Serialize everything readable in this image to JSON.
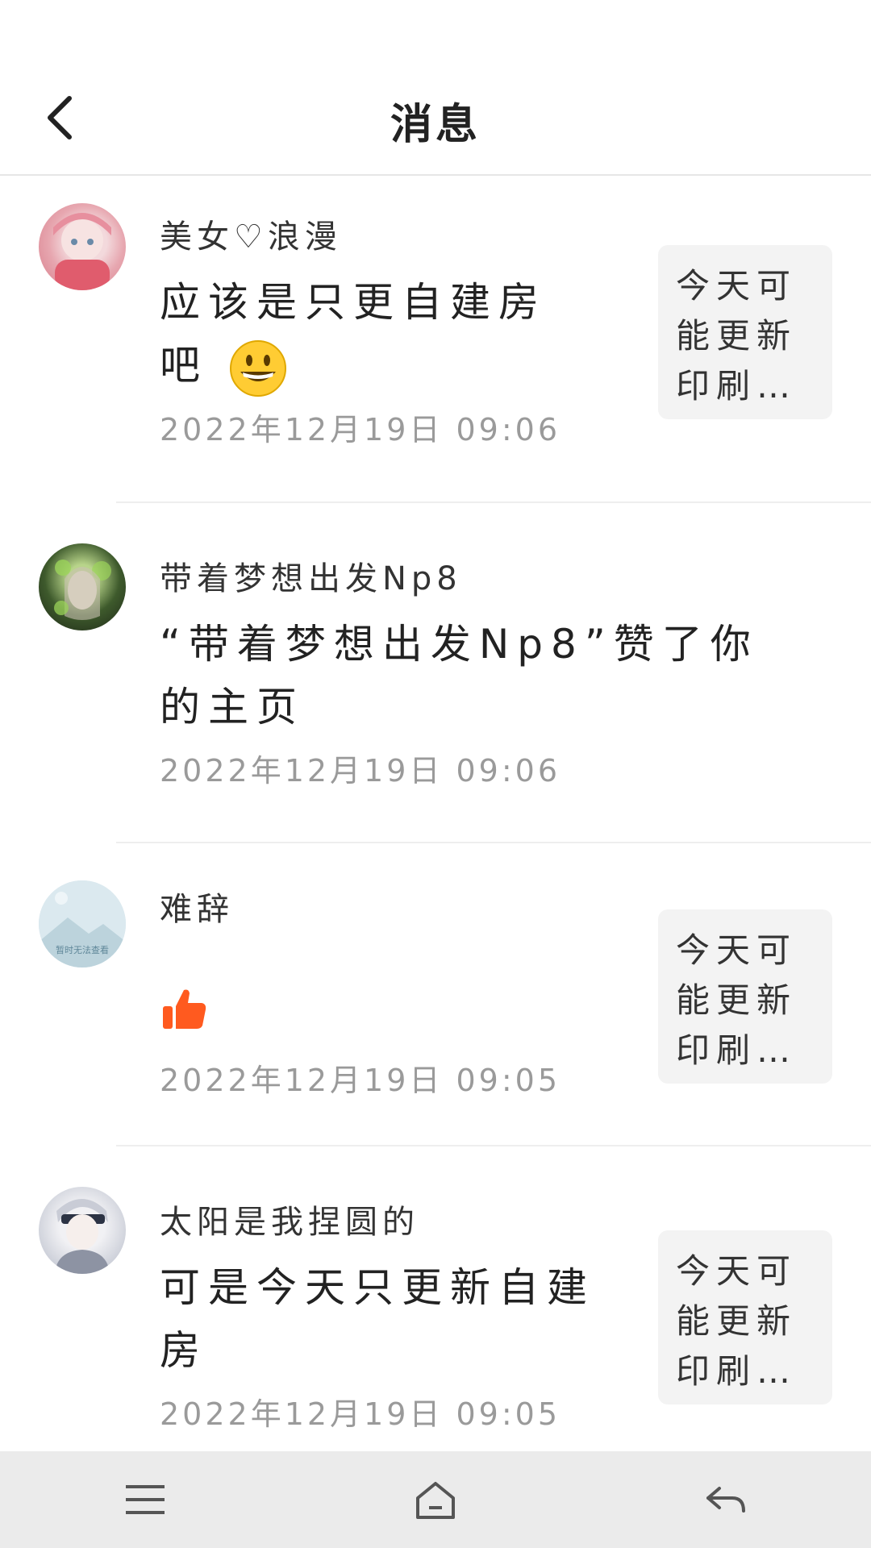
{
  "header": {
    "title": "消息"
  },
  "messages": [
    {
      "username": "美女♡浪漫",
      "text": "应该是只更自建房吧",
      "emoji": "grinning-face",
      "time": "2022年12月19日 09:06",
      "preview": "今天可能更新印刷…"
    },
    {
      "username": "带着梦想出发Np8",
      "text": "“带着梦想出发Np8”赞了你的主页",
      "time": "2022年12月19日 09:06"
    },
    {
      "username": "难辞",
      "icon": "thumbs-up-icon",
      "time": "2022年12月19日 09:05",
      "preview": "今天可能更新印刷…",
      "avatar_placeholder": "暂时无法查看"
    },
    {
      "username": "太阳是我捏圆的",
      "text": "可是今天只更新自建房",
      "time": "2022年12月19日 09:05",
      "preview": "今天可能更新印刷…"
    }
  ],
  "navbar": {
    "items": [
      "menu-icon",
      "home-icon",
      "back-icon"
    ]
  },
  "colors": {
    "like": "#ff5a1f",
    "divider": "#eeeeee",
    "nav_bg": "#ebebeb",
    "thumb_bg": "#f3f3f3"
  }
}
